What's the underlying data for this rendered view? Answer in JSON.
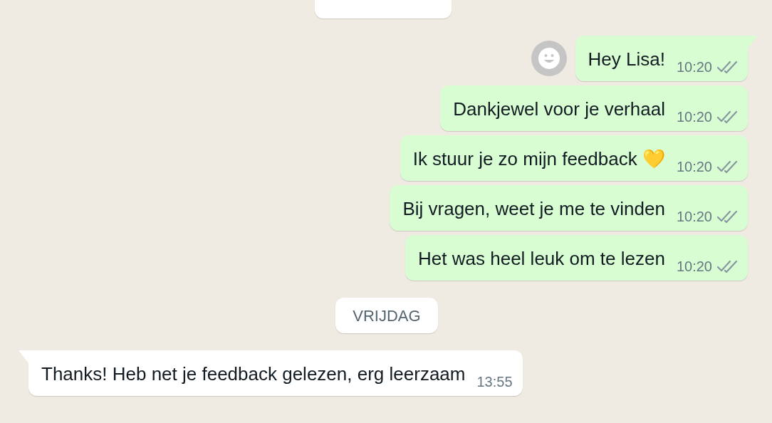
{
  "items": [
    {
      "kind": "date"
    },
    {
      "kind": "out",
      "text": "Hey Lisa!",
      "time": "10:20",
      "ticks": true,
      "tail": true,
      "avatar": true
    },
    {
      "kind": "out",
      "text": "Dankjewel voor je verhaal",
      "time": "10:20",
      "ticks": true,
      "tail": false,
      "avatar": false
    },
    {
      "kind": "out",
      "text": "Ik stuur je zo mijn feedback 💛",
      "time": "10:20",
      "ticks": true,
      "tail": false,
      "avatar": false
    },
    {
      "kind": "out",
      "text": "Bij vragen, weet je me te vinden",
      "time": "10:20",
      "ticks": true,
      "tail": false,
      "avatar": false
    },
    {
      "kind": "out",
      "text": "Het was heel leuk om te lezen",
      "time": "10:20",
      "ticks": true,
      "tail": false,
      "avatar": false
    },
    {
      "kind": "date",
      "text": "VRIJDAG"
    },
    {
      "kind": "in",
      "text": "Thanks! Heb net je feedback gelezen, erg leerzaam",
      "time": "13:55",
      "ticks": false,
      "tail": true,
      "avatar": false
    }
  ]
}
